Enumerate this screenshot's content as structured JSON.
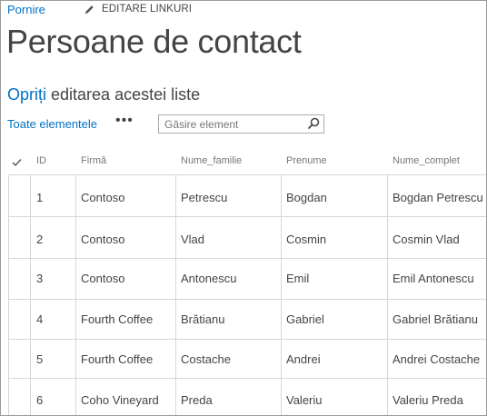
{
  "top_bar": {
    "home_link": "Pornire",
    "edit_links_label": "EDITARE LINKURI"
  },
  "page_title": "Persoane de contact",
  "edit_notice": {
    "link": "Opriți",
    "rest": " editarea acestei liste"
  },
  "toolbar": {
    "view_label": "Toate elementele",
    "more_label": "•••",
    "search_placeholder": "Găsire element"
  },
  "icons": {
    "edit": "pencil-icon",
    "search": "search-icon",
    "check": "checkmark-icon"
  },
  "colors": {
    "accent": "#0072c6",
    "text": "#444444",
    "muted": "#777777",
    "grid": "#d6d6d6"
  },
  "table": {
    "columns": [
      "ID",
      "Firmă",
      "Nume_familie",
      "Prenume",
      "Nume_complet"
    ],
    "rows": [
      [
        "1",
        "Contoso",
        "Petrescu",
        "Bogdan",
        "Bogdan Petrescu"
      ],
      [
        "2",
        "Contoso",
        "Vlad",
        "Cosmin",
        "Cosmin Vlad"
      ],
      [
        "3",
        "Contoso",
        "Antonescu",
        "Emil",
        "Emil Antonescu"
      ],
      [
        "4",
        "Fourth Coffee",
        "Brătianu",
        "Gabriel",
        "Gabriel Brătianu"
      ],
      [
        "5",
        "Fourth Coffee",
        "Costache",
        "Andrei",
        "Andrei Costache"
      ],
      [
        "6",
        "Coho Vineyard",
        "Preda",
        "Valeriu",
        "Valeriu Preda"
      ]
    ]
  }
}
